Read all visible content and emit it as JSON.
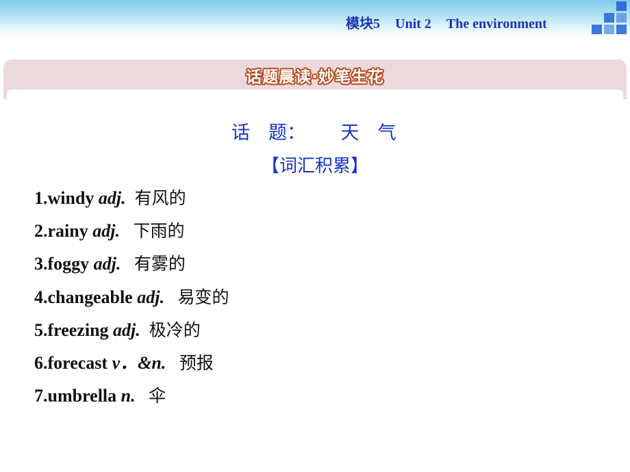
{
  "header": {
    "module": "模块5",
    "unit": "Unit 2",
    "title": "The environment",
    "accent_color": "#1a33b5",
    "decor_squares_colors": [
      "#2f6fd8",
      "#3a78dc",
      "#6fa3e0",
      "#3a78dc",
      "#7aa9e4",
      "#3c7bda"
    ]
  },
  "banner": {
    "title": "话题晨读·妙笔生花",
    "outline_color": "#b5481d"
  },
  "topic": {
    "label": "话　题：",
    "value": "天　气"
  },
  "section_title": "【词汇积累】",
  "vocabulary": [
    {
      "num": "1.",
      "word": "windy",
      "pos": "adj.",
      "gap": "  ",
      "meaning": "有风的"
    },
    {
      "num": "2.",
      "word": "rainy",
      "pos": "adj.",
      "gap": "   ",
      "meaning": "下雨的"
    },
    {
      "num": "3.",
      "word": "foggy",
      "pos": "adj.",
      "gap": "   ",
      "meaning": "有雾的"
    },
    {
      "num": "4.",
      "word": "changeable",
      "pos": "adj.",
      "gap": "   ",
      "meaning": "易变的"
    },
    {
      "num": "5.",
      "word": "freezing",
      "pos": "adj.",
      "gap": "  ",
      "meaning": "极冷的"
    },
    {
      "num": "6.",
      "word": "forecast",
      "pos": "v．&n.",
      "gap": "   ",
      "meaning": "预报"
    },
    {
      "num": "7.",
      "word": "umbrella",
      "pos": "n.",
      "gap": "   ",
      "meaning": "伞"
    }
  ]
}
